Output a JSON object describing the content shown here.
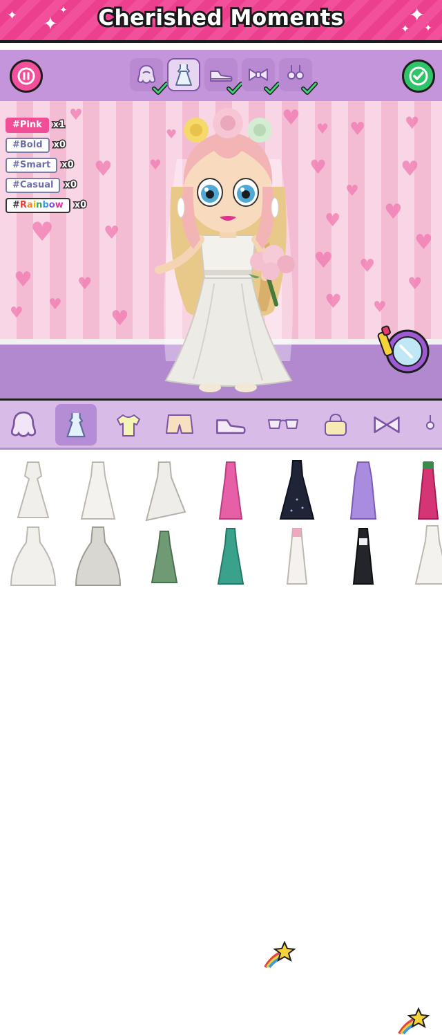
{
  "title": "Cherished Moments",
  "toolbar": {
    "pause_icon": "pause-icon",
    "confirm_icon": "checkmark-icon",
    "progress_categories": [
      {
        "name": "hair",
        "icon": "hair-icon",
        "done": true
      },
      {
        "name": "dress",
        "icon": "dress-icon",
        "done": false,
        "active": true
      },
      {
        "name": "shoes",
        "icon": "sneaker-icon",
        "done": true
      },
      {
        "name": "bow",
        "icon": "bow-icon",
        "done": true
      },
      {
        "name": "earrings",
        "icon": "earrings-icon",
        "done": true
      }
    ]
  },
  "style_tags": [
    {
      "label": "#Pink",
      "count": "x1"
    },
    {
      "label": "#Bold",
      "count": "x0"
    },
    {
      "label": "#Smart",
      "count": "x0"
    },
    {
      "label": "#Casual",
      "count": "x0"
    },
    {
      "label": "#Rainbow",
      "count": "x0"
    }
  ],
  "category_tabs": [
    "hair-icon",
    "dress-icon",
    "top-icon",
    "shorts-icon",
    "sneaker-icon",
    "glasses-icon",
    "handbag-icon",
    "bow-icon",
    "earrings-icon"
  ],
  "colors": {
    "banner_pink": "#f2509a",
    "toolbar_purple": "#c495da",
    "confirm_green": "#2fc46a",
    "tab_bar": "#d9bbe8"
  },
  "dress_items_row1": [
    "white-mermaid-gown",
    "white-a-line-gown",
    "white-high-low-gown",
    "pink-gown",
    "navy-sparkle-gown",
    "lavender-gown",
    "magenta-gown"
  ],
  "dress_items_row2": [
    "white-ball-gown",
    "silver-ball-gown",
    "sage-dress",
    "teal-gown",
    "white-pink-gown",
    "black-gown",
    "white-gown"
  ]
}
